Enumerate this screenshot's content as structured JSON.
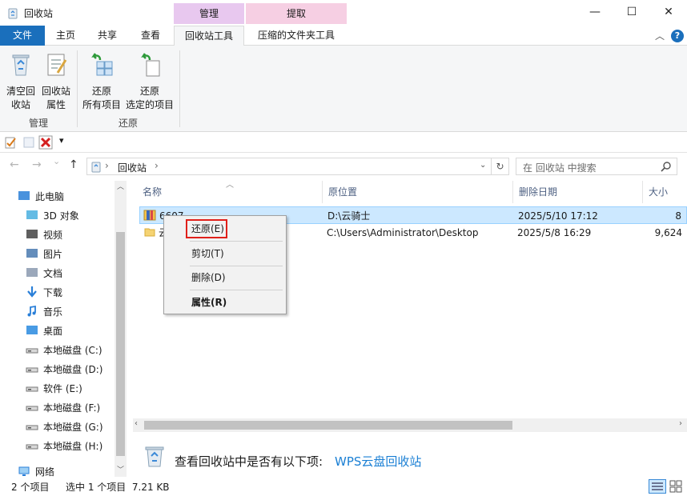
{
  "window": {
    "title": "回收站",
    "context_tabs": {
      "manage": "管理",
      "extract": "提取"
    },
    "controls": {
      "minimize": "—",
      "maximize": "☐",
      "close": "✕"
    }
  },
  "ribbon": {
    "tabs": [
      "文件",
      "主页",
      "共享",
      "查看",
      "回收站工具",
      "压缩的文件夹工具"
    ],
    "active_tab": "回收站工具",
    "help": "?",
    "buttons": {
      "empty": {
        "line1": "清空回",
        "line2": "收站"
      },
      "properties": {
        "line1": "回收站",
        "line2": "属性"
      },
      "restore_all": {
        "line1": "还原",
        "line2": "所有项目"
      },
      "restore_selected": {
        "line1": "还原",
        "line2": "选定的项目"
      }
    },
    "groups": {
      "manage": "管理",
      "restore": "还原"
    }
  },
  "quick_access": {
    "dropdown": "▾"
  },
  "nav": {
    "back": "←",
    "forward": "→",
    "recent": "⌄",
    "up": "↑",
    "breadcrumb_root": "回收站",
    "breadcrumb_chevron": "›",
    "refresh": "↻",
    "search_placeholder": "在 回收站 中搜索"
  },
  "sidebar": {
    "items": [
      {
        "label": "此电脑",
        "icon": "pc-icon"
      },
      {
        "label": "3D 对象",
        "icon": "cube-icon"
      },
      {
        "label": "视频",
        "icon": "video-icon"
      },
      {
        "label": "图片",
        "icon": "picture-icon"
      },
      {
        "label": "文档",
        "icon": "document-icon"
      },
      {
        "label": "下载",
        "icon": "download-icon"
      },
      {
        "label": "音乐",
        "icon": "music-icon"
      },
      {
        "label": "桌面",
        "icon": "desktop-icon"
      },
      {
        "label": "本地磁盘 (C:)",
        "icon": "drive-c-icon"
      },
      {
        "label": "本地磁盘 (D:)",
        "icon": "drive-icon"
      },
      {
        "label": "软件 (E:)",
        "icon": "drive-icon"
      },
      {
        "label": "本地磁盘 (F:)",
        "icon": "drive-icon"
      },
      {
        "label": "本地磁盘 (G:)",
        "icon": "drive-icon"
      },
      {
        "label": "本地磁盘 (H:)",
        "icon": "drive-icon"
      },
      {
        "label": "网络",
        "icon": "network-icon"
      }
    ]
  },
  "table": {
    "columns": [
      "名称",
      "原位置",
      "删除日期",
      "大小"
    ],
    "rows": [
      {
        "name": "6607",
        "location": "D:\\云骑士",
        "date": "2025/5/10 17:12",
        "size": "8"
      },
      {
        "name": "云",
        "location": "C:\\Users\\Administrator\\Desktop",
        "date": "2025/5/8 16:29",
        "size": "9,624"
      }
    ]
  },
  "context_menu": {
    "items": [
      "还原(E)",
      "剪切(T)",
      "删除(D)",
      "属性(R)"
    ]
  },
  "banner": {
    "text": "查看回收站中是否有以下项:",
    "link": "WPS云盘回收站"
  },
  "status": {
    "count": "2 个项目",
    "selection": "选中 1 个项目  7.21 KB"
  },
  "colors": {
    "accent": "#1a6fbc",
    "manage_tab": "#e8c8ef",
    "extract_tab": "#f6cfe3",
    "selection": "#cce8ff",
    "highlight_box": "#e0201a",
    "link": "#1a7fd4"
  }
}
